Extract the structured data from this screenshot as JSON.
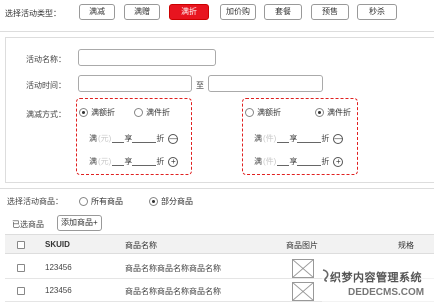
{
  "promo_type": {
    "label": "选择活动类型：",
    "buttons": [
      {
        "label": "满减",
        "active": false
      },
      {
        "label": "满赠",
        "active": false
      },
      {
        "label": "满折",
        "active": true
      },
      {
        "label": "加价购",
        "active": false
      },
      {
        "label": "套餐",
        "active": false
      },
      {
        "label": "预售",
        "active": false
      },
      {
        "label": "秒杀",
        "active": false
      }
    ]
  },
  "form": {
    "name_label": "活动名称：",
    "name_value": "",
    "time_label": "活动时间：",
    "time_start": "",
    "time_to": "至",
    "time_end": "",
    "mode_label": "满减方式：",
    "mode_left": {
      "options": [
        "满额折",
        "满件折"
      ],
      "selected": 0,
      "rule_prefix": "满",
      "unit_placeholder": "(元)",
      "rule_mid": "享",
      "rule_suffix": "折",
      "actions": [
        "—",
        "+"
      ]
    },
    "mode_right": {
      "options": [
        "满额折",
        "满件折"
      ],
      "selected": 1,
      "rule_prefix": "满",
      "unit_placeholder": "(件)",
      "rule_mid": "享",
      "rule_suffix": "折",
      "actions": [
        "—",
        "+"
      ]
    }
  },
  "goods": {
    "label": "选择活动商品：",
    "options": [
      "所有商品",
      "部分商品"
    ],
    "selected": 1,
    "selected_label": "已选商品",
    "add_button": "添加商品+"
  },
  "table": {
    "headers": [
      "SKUID",
      "商品名称",
      "商品图片",
      "规格"
    ],
    "rows": [
      {
        "skuid": "123456",
        "name": "商品名称商品名称商品名称"
      },
      {
        "skuid": "123456",
        "name": "商品名称商品名称商品名称"
      }
    ]
  },
  "watermark": {
    "line1": "织梦内容管理系统",
    "line2": "DEDECMS.COM"
  },
  "colors": {
    "accent": "#e8141f",
    "dashed_border": "#e02020"
  }
}
